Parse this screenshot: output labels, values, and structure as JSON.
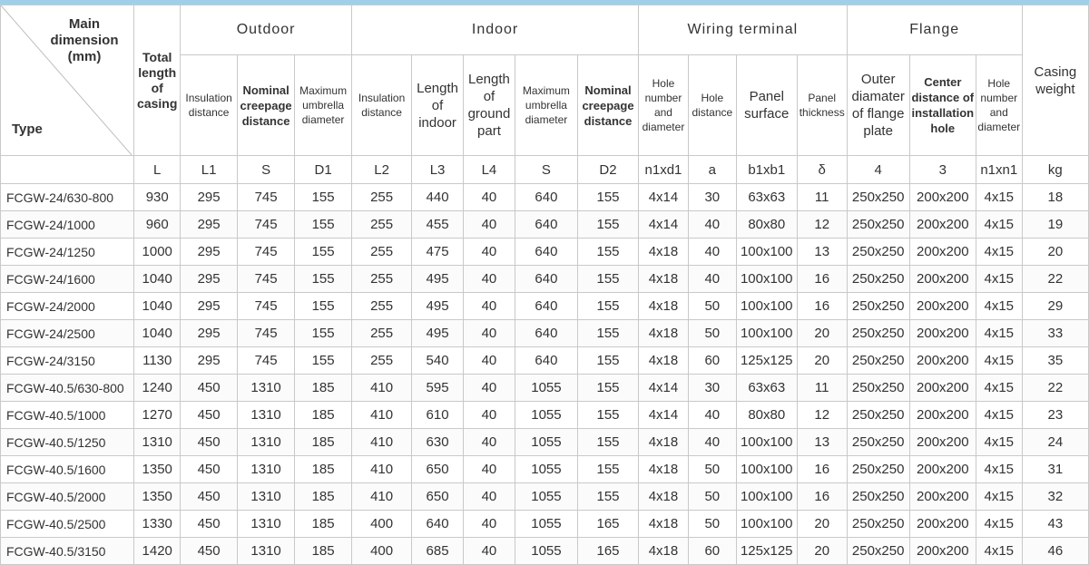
{
  "header": {
    "corner_main": "Main dimension (mm)",
    "corner_type": "Type",
    "total_length": "Total length of casing",
    "groups": {
      "outdoor": "Outdoor",
      "indoor": "Indoor",
      "wiring": "Wiring terminal",
      "flange": "Flange"
    },
    "casing_weight": "Casing weight",
    "sub": {
      "insulation_out": "Insulation distance",
      "nominal_creepage_out": "Nominal creepage distance",
      "max_umbrella_out": "Maximum umbrella diameter",
      "insulation_in": "Insulation distance",
      "length_indoor": "Length of indoor",
      "length_ground": "Length of ground part",
      "max_umbrella_in": "Maximum umbrella diameter",
      "nominal_creepage_in": "Nominal creepage distance",
      "hole_number": "Hole number and diameter",
      "hole_distance": "Hole distance",
      "panel_surface": "Panel surface",
      "panel_thickness": "Panel thickness",
      "outer_diameter": "Outer diamater of flange plate",
      "center_distance": "Center distance of installation hole",
      "flange_hole": "Hole number and diameter"
    },
    "codes": [
      "L",
      "L1",
      "S",
      "D1",
      "L2",
      "L3",
      "L4",
      "S",
      "D2",
      "n1xd1",
      "a",
      "b1xb1",
      "δ",
      "4",
      "3",
      "n1xn1",
      "kg"
    ]
  },
  "rows": [
    [
      "FCGW-24/630-800",
      "930",
      "295",
      "745",
      "155",
      "255",
      "440",
      "40",
      "640",
      "155",
      "4x14",
      "30",
      "63x63",
      "11",
      "250x250",
      "200x200",
      "4x15",
      "18"
    ],
    [
      "FCGW-24/1000",
      "960",
      "295",
      "745",
      "155",
      "255",
      "455",
      "40",
      "640",
      "155",
      "4x14",
      "40",
      "80x80",
      "12",
      "250x250",
      "200x200",
      "4x15",
      "19"
    ],
    [
      "FCGW-24/1250",
      "1000",
      "295",
      "745",
      "155",
      "255",
      "475",
      "40",
      "640",
      "155",
      "4x18",
      "40",
      "100x100",
      "13",
      "250x250",
      "200x200",
      "4x15",
      "20"
    ],
    [
      "FCGW-24/1600",
      "1040",
      "295",
      "745",
      "155",
      "255",
      "495",
      "40",
      "640",
      "155",
      "4x18",
      "40",
      "100x100",
      "16",
      "250x250",
      "200x200",
      "4x15",
      "22"
    ],
    [
      "FCGW-24/2000",
      "1040",
      "295",
      "745",
      "155",
      "255",
      "495",
      "40",
      "640",
      "155",
      "4x18",
      "50",
      "100x100",
      "16",
      "250x250",
      "200x200",
      "4x15",
      "29"
    ],
    [
      "FCGW-24/2500",
      "1040",
      "295",
      "745",
      "155",
      "255",
      "495",
      "40",
      "640",
      "155",
      "4x18",
      "50",
      "100x100",
      "20",
      "250x250",
      "200x200",
      "4x15",
      "33"
    ],
    [
      "FCGW-24/3150",
      "1130",
      "295",
      "745",
      "155",
      "255",
      "540",
      "40",
      "640",
      "155",
      "4x18",
      "60",
      "125x125",
      "20",
      "250x250",
      "200x200",
      "4x15",
      "35"
    ],
    [
      "FCGW-40.5/630-800",
      "1240",
      "450",
      "1310",
      "185",
      "410",
      "595",
      "40",
      "1055",
      "155",
      "4x14",
      "30",
      "63x63",
      "11",
      "250x250",
      "200x200",
      "4x15",
      "22"
    ],
    [
      "FCGW-40.5/1000",
      "1270",
      "450",
      "1310",
      "185",
      "410",
      "610",
      "40",
      "1055",
      "155",
      "4x14",
      "40",
      "80x80",
      "12",
      "250x250",
      "200x200",
      "4x15",
      "23"
    ],
    [
      "FCGW-40.5/1250",
      "1310",
      "450",
      "1310",
      "185",
      "410",
      "630",
      "40",
      "1055",
      "155",
      "4x18",
      "40",
      "100x100",
      "13",
      "250x250",
      "200x200",
      "4x15",
      "24"
    ],
    [
      "FCGW-40.5/1600",
      "1350",
      "450",
      "1310",
      "185",
      "410",
      "650",
      "40",
      "1055",
      "155",
      "4x18",
      "50",
      "100x100",
      "16",
      "250x250",
      "200x200",
      "4x15",
      "31"
    ],
    [
      "FCGW-40.5/2000",
      "1350",
      "450",
      "1310",
      "185",
      "410",
      "650",
      "40",
      "1055",
      "155",
      "4x18",
      "50",
      "100x100",
      "16",
      "250x250",
      "200x200",
      "4x15",
      "32"
    ],
    [
      "FCGW-40.5/2500",
      "1330",
      "450",
      "1310",
      "185",
      "400",
      "640",
      "40",
      "1055",
      "165",
      "4x18",
      "50",
      "100x100",
      "20",
      "250x250",
      "200x200",
      "4x15",
      "43"
    ],
    [
      "FCGW-40.5/3150",
      "1420",
      "450",
      "1310",
      "185",
      "400",
      "685",
      "40",
      "1055",
      "165",
      "4x18",
      "60",
      "125x125",
      "20",
      "250x250",
      "200x200",
      "4x15",
      "46"
    ]
  ]
}
